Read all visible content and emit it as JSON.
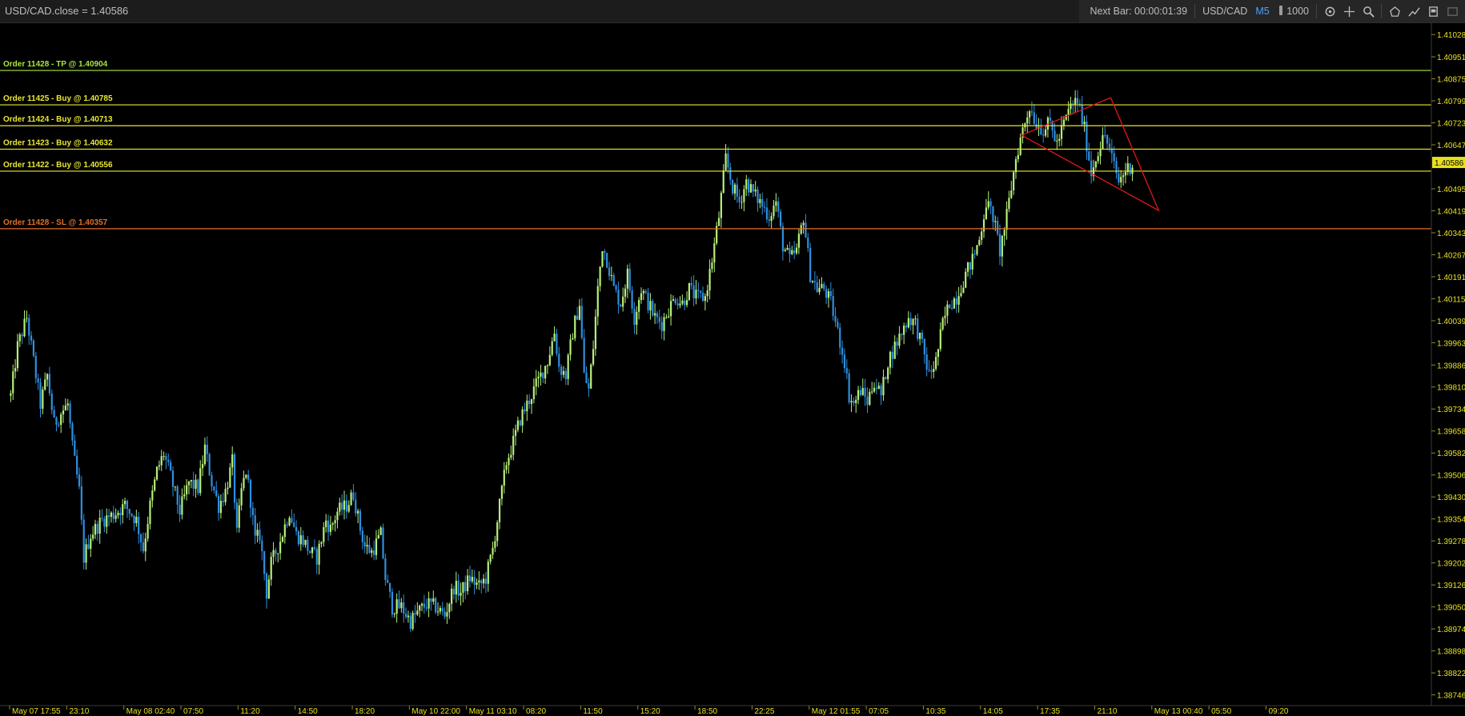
{
  "chart_title": "USD/CAD.close = 1.40586",
  "toolbar": {
    "next_bar": "Next Bar: 00:00:01:39",
    "symbol": "USD/CAD",
    "timeframe": "M5",
    "quantity": "1000"
  },
  "icons": [
    "refresh-icon",
    "crosshair-icon",
    "zoom-icon",
    "shape-icon",
    "trendline-icon",
    "panel-icon",
    "window-icon"
  ],
  "colors": {
    "background": "#000000",
    "up_candle": "#b6f07a",
    "down_candle": "#2f8fe0",
    "buy_line": "#e8e833",
    "tp_line": "#a8e83a",
    "sl_line": "#e07028",
    "triangle": "#e01818",
    "axis_text": "#e8e020"
  },
  "order_lines": [
    {
      "label": "Order 11428 - TP @ 1.40904",
      "price": 1.40904,
      "kind": "tp"
    },
    {
      "label": "Order 11425 - Buy @ 1.40785",
      "price": 1.40785,
      "kind": "buy"
    },
    {
      "label": "Order 11424 - Buy @ 1.40713",
      "price": 1.40713,
      "kind": "buy"
    },
    {
      "label": "Order 11423 - Buy @ 1.40632",
      "price": 1.40632,
      "kind": "buy"
    },
    {
      "label": "Order 11422 - Buy @ 1.40556",
      "price": 1.40556,
      "kind": "buy"
    },
    {
      "label": "Order 11428 - SL @ 1.40357",
      "price": 1.40357,
      "kind": "sl"
    }
  ],
  "current_price": "1.40586",
  "chart_data": {
    "type": "candlestick",
    "y_ticks": [
      "1.41028",
      "1.40951",
      "1.40875",
      "1.40799",
      "1.40723",
      "1.40647",
      "1.40495",
      "1.40419",
      "1.40343",
      "1.40267",
      "1.40191",
      "1.40115",
      "1.40039",
      "1.39963",
      "1.39886",
      "1.39810",
      "1.39734",
      "1.39658",
      "1.39582",
      "1.39506",
      "1.39430",
      "1.39354",
      "1.39278",
      "1.39202",
      "1.39126",
      "1.39050",
      "1.38974",
      "1.38898",
      "1.38822",
      "1.38746"
    ],
    "ylim": [
      1.3872,
      1.4107
    ],
    "x_ticks": [
      "May 07 17:55",
      "23:10",
      "May 08 02:40",
      "07:50",
      "11:20",
      "14:50",
      "18:20",
      "May 10 22:00",
      "May 11 03:10",
      "08:20",
      "11:50",
      "15:20",
      "18:50",
      "22:25",
      "May 12 01:55",
      "07:05",
      "10:35",
      "14:05",
      "17:35",
      "21:10",
      "May 13 00:40",
      "05:50",
      "09:20"
    ],
    "x_tick_positions": [
      0,
      25,
      50,
      75,
      100,
      125,
      150,
      175,
      200,
      225,
      250,
      275,
      300,
      325,
      350,
      375,
      400,
      425,
      450,
      475,
      500,
      525,
      550
    ],
    "close_path": [
      [
        0,
        1.3978
      ],
      [
        3,
        1.3995
      ],
      [
        7,
        1.4005
      ],
      [
        10,
        1.399
      ],
      [
        13,
        1.3975
      ],
      [
        16,
        1.3985
      ],
      [
        19,
        1.3968
      ],
      [
        22,
        1.3972
      ],
      [
        25,
        1.3975
      ],
      [
        27,
        1.396
      ],
      [
        30,
        1.3945
      ],
      [
        32,
        1.3922
      ],
      [
        35,
        1.393
      ],
      [
        40,
        1.3935
      ],
      [
        45,
        1.3937
      ],
      [
        50,
        1.394
      ],
      [
        55,
        1.3935
      ],
      [
        58,
        1.3925
      ],
      [
        61,
        1.394
      ],
      [
        64,
        1.3952
      ],
      [
        67,
        1.3958
      ],
      [
        70,
        1.395
      ],
      [
        74,
        1.3938
      ],
      [
        78,
        1.3948
      ],
      [
        82,
        1.3946
      ],
      [
        85,
        1.396
      ],
      [
        88,
        1.3948
      ],
      [
        91,
        1.394
      ],
      [
        94,
        1.3945
      ],
      [
        97,
        1.3955
      ],
      [
        99,
        1.393
      ],
      [
        101,
        1.3945
      ],
      [
        103,
        1.3952
      ],
      [
        105,
        1.3942
      ],
      [
        107,
        1.3928
      ],
      [
        109,
        1.393
      ],
      [
        112,
        1.391
      ],
      [
        114,
        1.392
      ],
      [
        118,
        1.3928
      ],
      [
        122,
        1.3938
      ],
      [
        125,
        1.393
      ],
      [
        128,
        1.3928
      ],
      [
        131,
        1.3924
      ],
      [
        134,
        1.3922
      ],
      [
        138,
        1.3935
      ],
      [
        140,
        1.3932
      ],
      [
        143,
        1.3938
      ],
      [
        147,
        1.394
      ],
      [
        150,
        1.3944
      ],
      [
        153,
        1.3932
      ],
      [
        155,
        1.3926
      ],
      [
        158,
        1.3924
      ],
      [
        162,
        1.393
      ],
      [
        164,
        1.3915
      ],
      [
        167,
        1.3905
      ],
      [
        171,
        1.3905
      ],
      [
        175,
        1.39
      ],
      [
        178,
        1.3903
      ],
      [
        182,
        1.3906
      ],
      [
        186,
        1.3905
      ],
      [
        190,
        1.3902
      ],
      [
        194,
        1.3912
      ],
      [
        197,
        1.391
      ],
      [
        201,
        1.3915
      ],
      [
        205,
        1.3912
      ],
      [
        208,
        1.3915
      ],
      [
        211,
        1.3925
      ],
      [
        214,
        1.394
      ],
      [
        217,
        1.3955
      ],
      [
        220,
        1.3962
      ],
      [
        223,
        1.397
      ],
      [
        226,
        1.3975
      ],
      [
        229,
        1.398
      ],
      [
        232,
        1.3985
      ],
      [
        235,
        1.399
      ],
      [
        238,
        1.4
      ],
      [
        240,
        1.3988
      ],
      [
        243,
        1.3985
      ],
      [
        246,
        1.4
      ],
      [
        249,
        1.401
      ],
      [
        251,
        1.3985
      ],
      [
        253,
        1.398
      ],
      [
        255,
        1.3995
      ],
      [
        257,
        1.4015
      ],
      [
        259,
        1.403
      ],
      [
        261,
        1.4025
      ],
      [
        264,
        1.4015
      ],
      [
        267,
        1.401
      ],
      [
        270,
        1.402
      ],
      [
        273,
        1.4005
      ],
      [
        276,
        1.4015
      ],
      [
        279,
        1.401
      ],
      [
        282,
        1.4005
      ],
      [
        285,
        1.4003
      ],
      [
        288,
        1.4008
      ],
      [
        291,
        1.4012
      ],
      [
        294,
        1.401
      ],
      [
        297,
        1.4015
      ],
      [
        300,
        1.4012
      ],
      [
        304,
        1.4012
      ],
      [
        307,
        1.4025
      ],
      [
        310,
        1.404
      ],
      [
        313,
        1.406
      ],
      [
        316,
        1.405
      ],
      [
        319,
        1.4045
      ],
      [
        322,
        1.4052
      ],
      [
        325,
        1.4048
      ],
      [
        328,
        1.4045
      ],
      [
        332,
        1.404
      ],
      [
        335,
        1.4045
      ],
      [
        338,
        1.403
      ],
      [
        341,
        1.4025
      ],
      [
        344,
        1.4028
      ],
      [
        347,
        1.404
      ],
      [
        350,
        1.402
      ],
      [
        353,
        1.4015
      ],
      [
        356,
        1.4015
      ],
      [
        359,
        1.401
      ],
      [
        362,
        1.4
      ],
      [
        365,
        1.399
      ],
      [
        367,
        1.3978
      ],
      [
        369,
        1.3975
      ],
      [
        372,
        1.398
      ],
      [
        375,
        1.3976
      ],
      [
        378,
        1.3983
      ],
      [
        381,
        1.3978
      ],
      [
        384,
        1.399
      ],
      [
        387,
        1.3995
      ],
      [
        390,
        1.4
      ],
      [
        393,
        1.4005
      ],
      [
        396,
        1.4003
      ],
      [
        399,
        1.3995
      ],
      [
        402,
        1.3985
      ],
      [
        405,
        1.399
      ],
      [
        408,
        1.4003
      ],
      [
        411,
        1.401
      ],
      [
        414,
        1.4012
      ],
      [
        418,
        1.402
      ],
      [
        421,
        1.4025
      ],
      [
        424,
        1.4032
      ],
      [
        427,
        1.4045
      ],
      [
        430,
        1.404
      ],
      [
        433,
        1.4028
      ],
      [
        436,
        1.404
      ],
      [
        438,
        1.405
      ],
      [
        440,
        1.406
      ],
      [
        443,
        1.407
      ],
      [
        446,
        1.4078
      ],
      [
        449,
        1.4072
      ],
      [
        452,
        1.407
      ],
      [
        455,
        1.4072
      ],
      [
        458,
        1.4065
      ],
      [
        461,
        1.4072
      ],
      [
        464,
        1.4078
      ],
      [
        467,
        1.408
      ],
      [
        470,
        1.407
      ],
      [
        473,
        1.4055
      ],
      [
        476,
        1.4063
      ],
      [
        479,
        1.4068
      ],
      [
        482,
        1.406
      ],
      [
        485,
        1.4052
      ],
      [
        488,
        1.4056
      ],
      [
        491,
        1.4058
      ]
    ],
    "triangle": [
      [
        443,
        1.4068
      ],
      [
        482,
        1.4081
      ],
      [
        503,
        1.4042
      ]
    ]
  }
}
